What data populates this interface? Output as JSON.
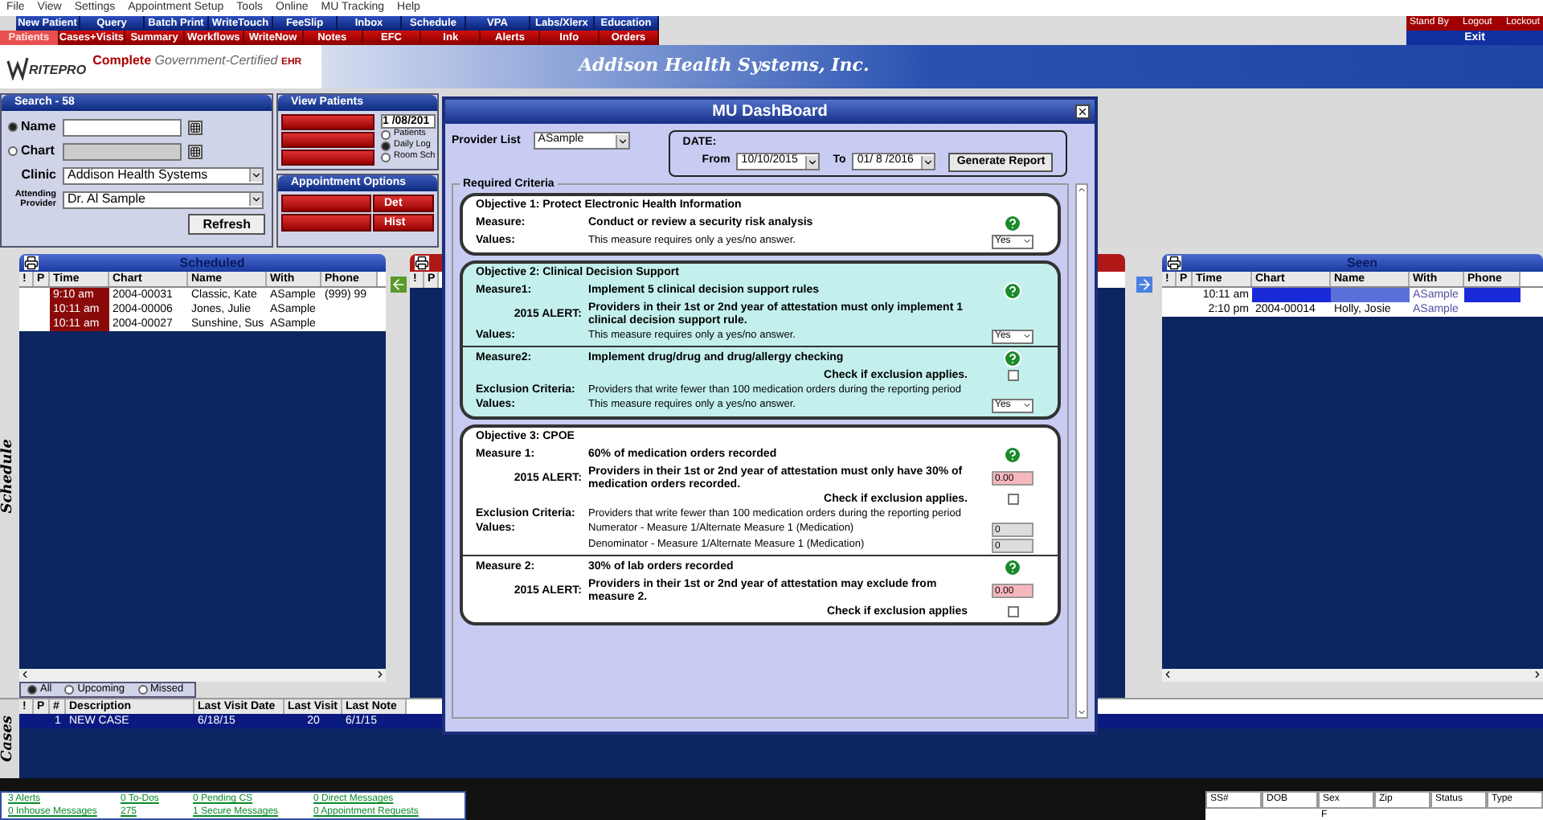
{
  "menu": [
    "File",
    "View",
    "Settings",
    "Appointment Setup",
    "Tools",
    "Online",
    "MU Tracking",
    "Help"
  ],
  "toolbar_blue": [
    "New Patient",
    "Query",
    "Batch Print",
    "WriteTouch",
    "FeeSlip",
    "Inbox",
    "Schedule",
    "VPA",
    "Labs/Xlerx",
    "Education"
  ],
  "toolbar_red": [
    {
      "label": "Patients",
      "selected": true
    },
    {
      "label": "Cases+Visits",
      "selected": false
    },
    {
      "label": "Summary",
      "selected": false
    },
    {
      "label": "Workflows",
      "selected": false
    },
    {
      "label": "WriteNow",
      "selected": false
    },
    {
      "label": "Notes",
      "selected": false
    },
    {
      "label": "EFC",
      "selected": false
    },
    {
      "label": "Ink",
      "selected": false
    },
    {
      "label": "Alerts",
      "selected": false
    },
    {
      "label": "Info",
      "selected": false
    },
    {
      "label": "Orders",
      "selected": false
    }
  ],
  "session": {
    "buttons": [
      "Stand By",
      "Logout",
      "Lockout"
    ],
    "exit": "Exit"
  },
  "banner": {
    "logo": "RITEPRO",
    "tagline_lead": "Complete",
    "tagline_main": "Government-Certified",
    "tagline_tail": "EHR",
    "company": "Addison Health Systems, Inc."
  },
  "search": {
    "title": "Search -  58",
    "options": [
      {
        "label": "Name",
        "selected": true,
        "disabled": false
      },
      {
        "label": "Chart",
        "selected": false,
        "disabled": true
      }
    ],
    "clinic_label": "Clinic",
    "clinic": "Addison Health Systems",
    "provider_label": "Attending Provider",
    "provider": "Dr. Al Sample",
    "refresh": "Refresh"
  },
  "view_patients": {
    "title": "View Patients",
    "date": "1 /08/201",
    "views": [
      {
        "label": "Patients",
        "selected": false
      },
      {
        "label": "Daily Log",
        "selected": true
      },
      {
        "label": "Room Sch",
        "selected": false
      }
    ]
  },
  "appointment_options": {
    "title": "Appointment Options",
    "buttons": [
      "Det",
      "Hist"
    ]
  },
  "schedule_label": "Schedule",
  "scheduled": {
    "title": "Scheduled",
    "columns": [
      "!",
      "P",
      "Time",
      "Chart",
      "Name",
      "With",
      "Phone"
    ],
    "rows": [
      {
        "time": "9:10 am",
        "chart": "2004-00031",
        "name": "Classic, Kate",
        "with": "ASample",
        "phone": "(999) 99"
      },
      {
        "time": "10:11 am",
        "chart": "2004-00006",
        "name": "Jones, Julie",
        "with": "ASample"
      },
      {
        "time": "10:11 am",
        "chart": "2004-00027",
        "name": "Sunshine, Sus",
        "with": "ASample"
      }
    ],
    "filters": [
      {
        "label": "All",
        "selected": true
      },
      {
        "label": "Upcoming",
        "selected": false
      },
      {
        "label": "Missed",
        "selected": false
      }
    ]
  },
  "middle": {
    "columns": [
      "!",
      "P"
    ]
  },
  "seen": {
    "title": "Seen",
    "columns": [
      "!",
      "P",
      "Time",
      "Chart",
      "Name",
      "With",
      "Phone"
    ],
    "rows": [
      {
        "time": "10:11 am",
        "with": "ASample",
        "selected": true
      },
      {
        "time": "2:10 pm",
        "chart": "2004-00014",
        "name": "Holly, Josie",
        "with": "ASample",
        "selected": false
      }
    ]
  },
  "cases": {
    "label": "Cases",
    "columns": [
      "!",
      "P",
      "#",
      "Description",
      "Last Visit Date",
      "Last Visit",
      "Last Note"
    ],
    "rows": [
      {
        "number": "1",
        "description": "NEW CASE",
        "last_visit_date": "6/18/15",
        "last_visit": "20",
        "last_note": "6/1/15",
        "selected": true
      }
    ]
  },
  "status": {
    "links": [
      "3 Alerts",
      "0 To-Dos",
      "0 Pending CS",
      "0 Direct Messages",
      "0 Inhouse Messages",
      "275",
      "1 Secure Messages",
      "0 Appointment Requests"
    ],
    "patient_columns": [
      {
        "label": "SS#"
      },
      {
        "label": "DOB"
      },
      {
        "label": "Sex",
        "value": "F"
      },
      {
        "label": "Zip"
      },
      {
        "label": "Status"
      },
      {
        "label": "Type"
      }
    ]
  },
  "modal": {
    "title": "MU DashBoard",
    "provider_label": "Provider List",
    "provider": "ASample",
    "date_label": "DATE:",
    "from_label": "From",
    "from": "10/10/2015",
    "to_label": "To",
    "to": "01/ 8 /2016",
    "generate": "Generate Report",
    "group_label": "Required Criteria",
    "objectives": [
      {
        "kind": "plain",
        "sections": [
          {
            "title": "Objective 1: Protect Electronic Health Information",
            "rows": [
              {
                "kind": "measure",
                "label": "Measure:",
                "text": "Conduct or review a security risk analysis"
              },
              {
                "kind": "select",
                "label": "Values:",
                "text": "This measure requires only a yes/no answer.",
                "value": "Yes"
              }
            ]
          }
        ]
      },
      {
        "kind": "highlighted",
        "sections": [
          {
            "title": "Objective 2:   Clinical Decision Support",
            "rows": [
              {
                "kind": "measure",
                "label": "Measure1:",
                "text": "Implement 5 clinical decision support rules"
              },
              {
                "kind": "alert",
                "label": "2015 ALERT:",
                "text": "Providers in their 1st or 2nd year of attestation must only implement 1 clinical decision support rule."
              },
              {
                "kind": "select",
                "label": "Values:",
                "text": "This measure requires only a yes/no answer.",
                "value": "Yes"
              }
            ]
          },
          {
            "rows": [
              {
                "kind": "measure",
                "label": "Measure2:",
                "text": "Implement drug/drug and drug/allergy checking"
              },
              {
                "kind": "check",
                "text": "Check if exclusion applies.",
                "checked": false
              },
              {
                "kind": "exclusion",
                "label": "Exclusion Criteria:",
                "text": "Providers that write fewer than 100 medication orders during the reporting period"
              },
              {
                "kind": "select",
                "label": "Values:",
                "text": "This measure requires only a yes/no answer.",
                "value": "Yes"
              }
            ]
          }
        ]
      },
      {
        "kind": "plain",
        "sections": [
          {
            "title": "Objective 3: CPOE",
            "rows": [
              {
                "kind": "measure",
                "label": "Measure 1:",
                "text": "60% of medication orders recorded"
              },
              {
                "kind": "alert",
                "label": "2015 ALERT:",
                "text": "Providers in their 1st or 2nd year of attestation must only have 30% of medication orders recorded.",
                "value": "0.00"
              },
              {
                "kind": "check",
                "text": "Check if exclusion applies.",
                "checked": false
              },
              {
                "kind": "exclusion",
                "label": "Exclusion Criteria:",
                "text": "Providers that write fewer than 100 medication orders during the reporting period"
              },
              {
                "kind": "input",
                "label": "Values:",
                "text": "Numerator - Measure 1/Alternate Measure 1 (Medication)",
                "value": "0"
              },
              {
                "kind": "input",
                "text": "Denominator - Measure 1/Alternate Measure 1 (Medication)",
                "value": "0"
              }
            ]
          },
          {
            "rows": [
              {
                "kind": "measure",
                "label": "Measure 2:",
                "text": "30% of lab orders recorded"
              },
              {
                "kind": "alert",
                "label": "2015 ALERT:",
                "text": "Providers in their 1st or 2nd year of attestation may exclude from measure 2.",
                "value": "0.00"
              },
              {
                "kind": "check",
                "text": "Check if exclusion applies",
                "checked": false
              }
            ]
          }
        ]
      }
    ]
  }
}
